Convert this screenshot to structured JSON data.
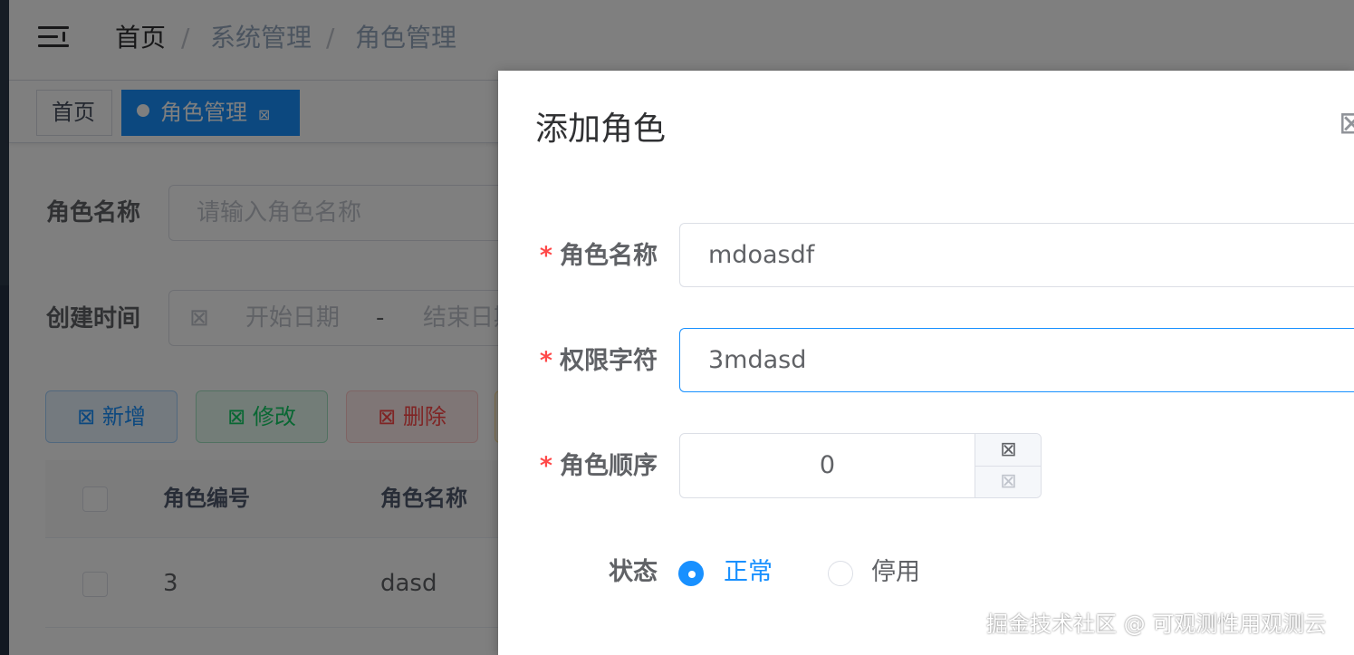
{
  "header": {
    "breadcrumb": [
      "首页",
      "系统管理",
      "角色管理"
    ],
    "separator": "/",
    "menu_icon": "hamburger-fold-icon"
  },
  "tags": [
    {
      "label": "首页",
      "active": false
    },
    {
      "label": "角色管理",
      "active": true,
      "close_glyph": "⊠"
    }
  ],
  "search": {
    "role_name_label": "角色名称",
    "role_name_placeholder": "请输入角色名称",
    "created_time_label": "创建时间",
    "calendar_icon": "⊠",
    "start_placeholder": "开始日期",
    "range_separator": "-",
    "end_placeholder": "结束日期"
  },
  "toolbar": {
    "icon_glyph": "⊠",
    "add_label": "新增",
    "edit_label": "修改",
    "delete_label": "删除"
  },
  "table": {
    "columns": [
      "角色编号",
      "角色名称"
    ],
    "rows": [
      {
        "id": "3",
        "name": "dasd"
      }
    ]
  },
  "dialog": {
    "title": "添加角色",
    "close_glyph": "⊠",
    "required_mark": "*",
    "fields": {
      "role_name": {
        "label": "角色名称",
        "value": "mdoasdf"
      },
      "role_key": {
        "label": "权限字符",
        "value": "3mdasd"
      },
      "role_sort": {
        "label": "角色顺序",
        "value": "0",
        "up_glyph": "⊠",
        "down_glyph": "⊠"
      },
      "status": {
        "label": "状态",
        "options": [
          "正常",
          "停用"
        ],
        "selected": "正常"
      }
    }
  },
  "watermark": "掘金技术社区 @ 可观测性用观测云",
  "colors": {
    "primary": "#1890ff",
    "danger": "#ff4949",
    "success": "#13ce66"
  }
}
